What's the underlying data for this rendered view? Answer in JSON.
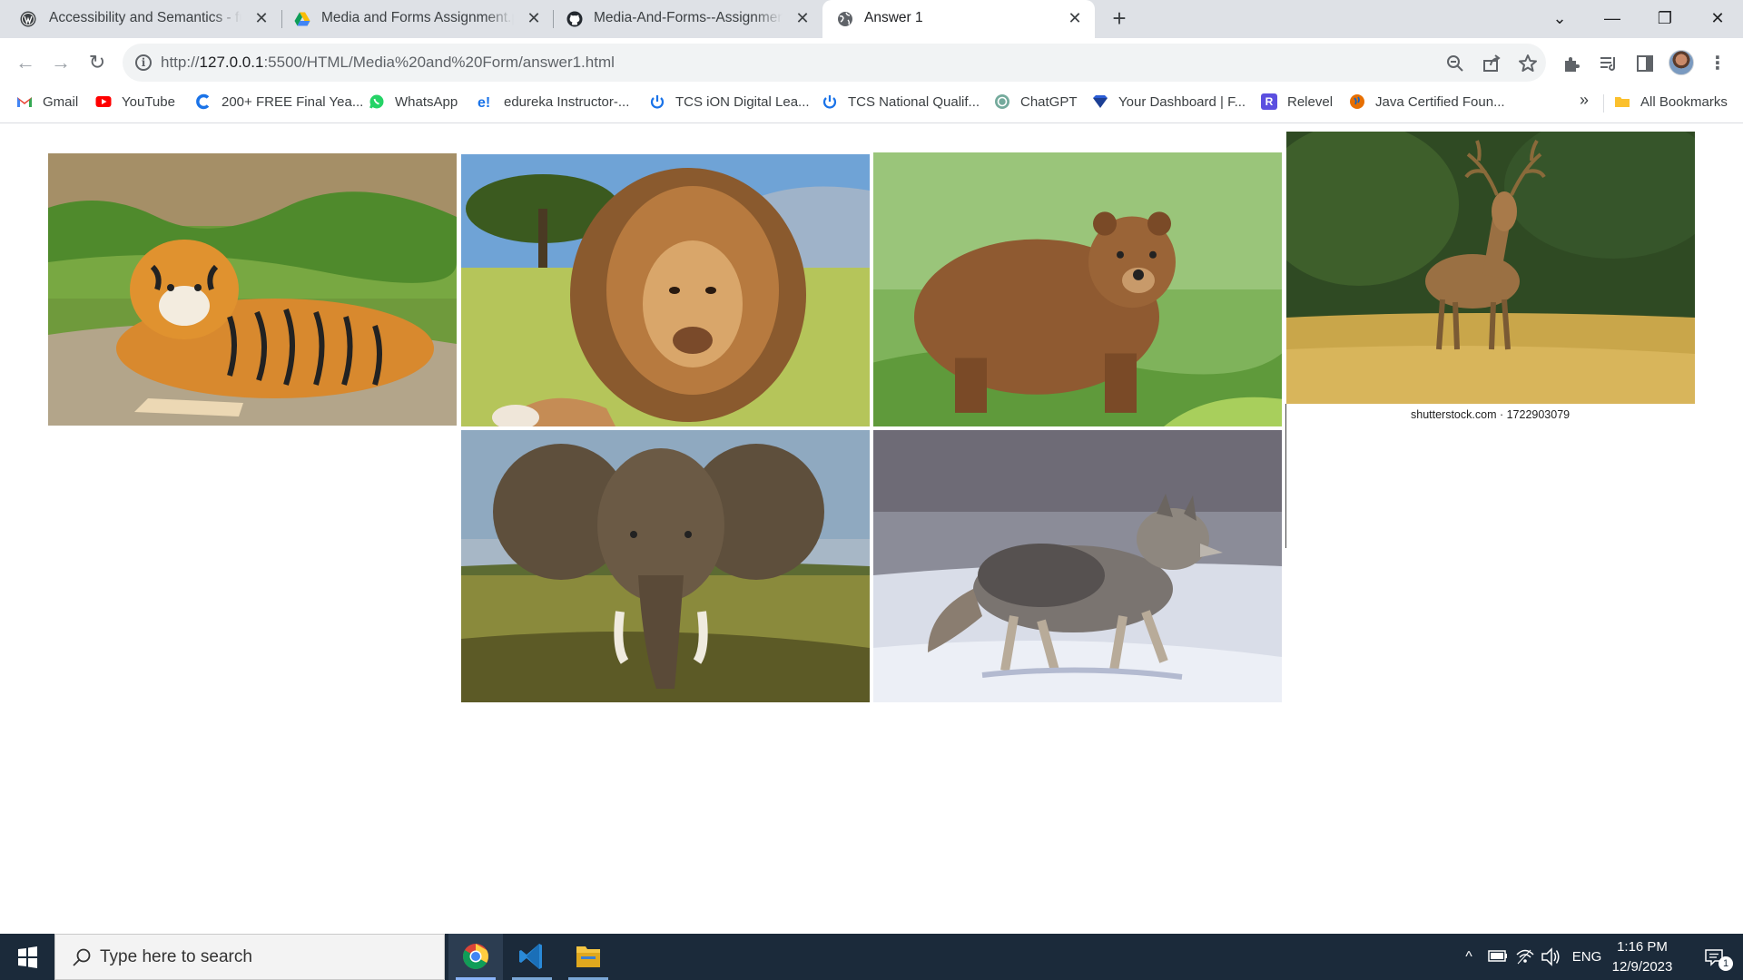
{
  "browser": {
    "tabs": [
      {
        "title": "Accessibility and Semantics - full",
        "icon": "wordpress-icon",
        "active": false
      },
      {
        "title": "Media and Forms Assignment.pdf",
        "icon": "google-drive-icon",
        "active": false
      },
      {
        "title": "Media-And-Forms--Assignment",
        "icon": "github-icon",
        "active": false
      },
      {
        "title": "Answer 1",
        "icon": "globe-icon",
        "active": true
      }
    ],
    "new_tab_label": "+",
    "window_controls": {
      "tab_search": "⌄",
      "minimize": "—",
      "restore": "❐",
      "close": "✕"
    },
    "address": {
      "prefix": "http://",
      "host": "127.0.0.1",
      "path": ":5500/HTML/Media%20and%20Form/answer1.html"
    },
    "bookmarks": [
      {
        "label": "Gmail",
        "icon": "gmail-icon",
        "color": "#ea4335"
      },
      {
        "label": "YouTube",
        "icon": "youtube-icon",
        "color": "#ff0000"
      },
      {
        "label": "200+ FREE Final Yea...",
        "icon": "c-logo-icon",
        "color": "#1a73e8"
      },
      {
        "label": "WhatsApp",
        "icon": "whatsapp-icon",
        "color": "#25d366"
      },
      {
        "label": "edureka Instructor-...",
        "icon": "edureka-icon",
        "color": "#1a73e8"
      },
      {
        "label": "TCS iON Digital Lea...",
        "icon": "power-icon",
        "color": "#1a73e8"
      },
      {
        "label": "TCS National Qualif...",
        "icon": "power-icon",
        "color": "#1a73e8"
      },
      {
        "label": "ChatGPT",
        "icon": "chatgpt-icon",
        "color": "#74aa9c"
      },
      {
        "label": "Your Dashboard | F...",
        "icon": "diamond-icon",
        "color": "#1c3f94"
      },
      {
        "label": "Relevel",
        "icon": "relevel-icon",
        "color": "#5b4fe0"
      },
      {
        "label": "Java Certified Foun...",
        "icon": "java-icon",
        "color": "#e76f00"
      }
    ],
    "bookmarks_more": "»",
    "all_bookmarks": "All Bookmarks"
  },
  "page": {
    "images": [
      {
        "subject": "tiger"
      },
      {
        "subject": "lion"
      },
      {
        "subject": "bear"
      },
      {
        "subject": "deer",
        "caption": "shutterstock.com · 1722903079"
      },
      {
        "subject": "elephant"
      },
      {
        "subject": "wolf"
      }
    ]
  },
  "taskbar": {
    "search_placeholder": "Type here to search",
    "apps": [
      {
        "name": "chrome-icon",
        "active": true
      },
      {
        "name": "vscode-icon",
        "active": false
      },
      {
        "name": "file-explorer-icon",
        "active": false
      }
    ],
    "tray": {
      "chevron": "^",
      "language": "ENG",
      "notifications": "1"
    },
    "time": "1:16 PM",
    "date": "12/9/2023"
  },
  "colors": {
    "tab_strip": "#dee1e6",
    "omnibox": "#f1f3f4",
    "taskbar": "#1b2a3a",
    "search_box": "#f3f3f3"
  }
}
